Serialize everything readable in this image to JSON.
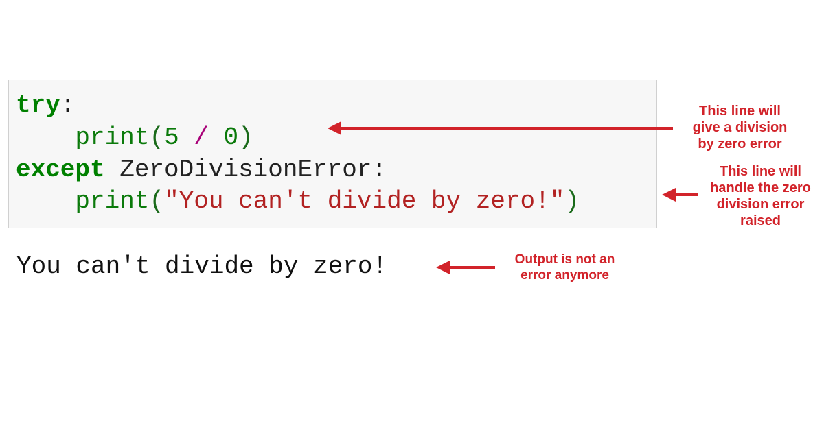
{
  "code": {
    "line1": {
      "kw": "try",
      "colon": ":"
    },
    "line2": {
      "indent": "    ",
      "func": "print",
      "open": "(",
      "num1": "5",
      "sp1": " ",
      "op": "/",
      "sp2": " ",
      "num2": "0",
      "close": ")"
    },
    "line3": {
      "kw": "except",
      "sp": " ",
      "exc": "ZeroDivisionError",
      "colon": ":"
    },
    "line4": {
      "indent": "    ",
      "func": "print",
      "open": "(",
      "str": "\"You can't divide by zero!\"",
      "close": ")"
    }
  },
  "output": "You can't divide by zero!",
  "annotations": {
    "a1": {
      "l1": "This line will",
      "l2": "give a division",
      "l3": "by zero error"
    },
    "a2": {
      "l1": "This line will",
      "l2": "handle the zero",
      "l3": "division error",
      "l4": "raised"
    },
    "a3": {
      "l1": "Output is not an",
      "l2": "error anymore"
    }
  },
  "colors": {
    "annotation": "#d2232a",
    "codebg": "#f7f7f7",
    "keyword": "#008000",
    "string": "#b22222"
  }
}
